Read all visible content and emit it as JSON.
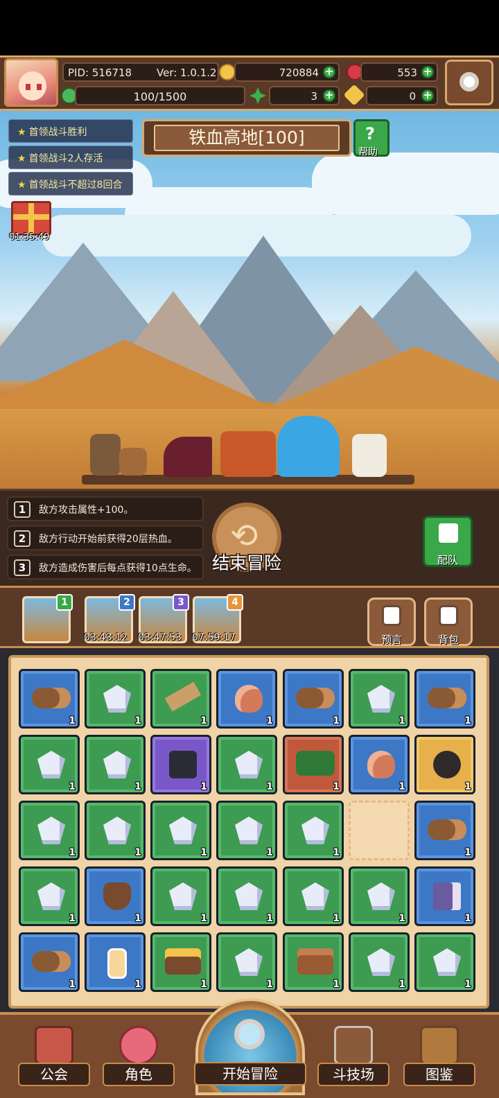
{
  "header": {
    "pid": "PID: 516718",
    "version": "Ver: 1.0.1.2",
    "gold": "720884",
    "gems": "553",
    "stamina": "100/1500",
    "clover": "3",
    "key": "0"
  },
  "area": {
    "name": "铁血高地[100]",
    "help_label": "帮助"
  },
  "quests": [
    {
      "label": "首领战斗胜利"
    },
    {
      "label": "首领战斗2人存活"
    },
    {
      "label": "首领战斗不超过8回合"
    }
  ],
  "gift": {
    "timer": "01:35:49"
  },
  "modifiers": [
    {
      "num": "1",
      "text": "敌方攻击属性+100。"
    },
    {
      "num": "2",
      "text": "敌方行动开始前获得20层热血。"
    },
    {
      "num": "3",
      "text": "敌方造成伤害后每点获得10点生命。"
    }
  ],
  "actions": {
    "end_adventure": "结束冒险",
    "team": "配队",
    "prophecy": "预言",
    "backpack": "背包"
  },
  "maps": [
    {
      "badge": "1",
      "timer": "",
      "badge_color": "#3aa848"
    },
    {
      "badge": "2",
      "timer": "03:43:12",
      "badge_color": "#3d78c7"
    },
    {
      "badge": "3",
      "timer": "03:47:53",
      "badge_color": "#7a57c9"
    },
    {
      "badge": "4",
      "timer": "07:59:17",
      "badge_color": "#e7953a"
    }
  ],
  "inventory": [
    [
      "log-blue",
      "crystal-green",
      "plank-green",
      "meat-blue",
      "log-blue",
      "crystal-green",
      "log-blue"
    ],
    [
      "crystal-green",
      "crystal-green",
      "boots-purple",
      "crystal-green",
      "bush-red",
      "meat-blue",
      "pot-gold"
    ],
    [
      "crystal-green",
      "crystal-green",
      "crystal-green",
      "crystal-green",
      "crystal-green",
      "empty",
      "log-blue"
    ],
    [
      "crystal-green",
      "fur-blue",
      "crystal-green",
      "crystal-green",
      "crystal-green",
      "crystal-green",
      "box-blue"
    ],
    [
      "log-blue",
      "jar-blue",
      "gold-green",
      "crystal-green",
      "chest-green",
      "crystal-green",
      "crystal-green"
    ]
  ],
  "inventory_count": "1",
  "nav": {
    "guild": "公会",
    "character": "角色",
    "start": "开始冒险",
    "arena": "斗技场",
    "codex": "图鉴"
  }
}
